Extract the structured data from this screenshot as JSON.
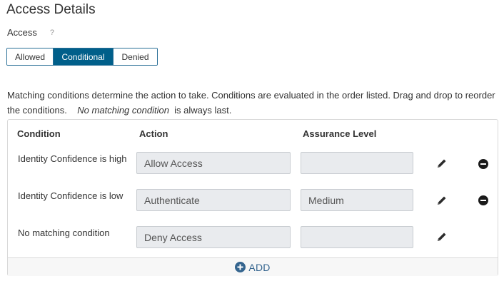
{
  "page": {
    "title": "Access Details"
  },
  "access": {
    "label": "Access",
    "help": "?",
    "options": [
      "Allowed",
      "Conditional",
      "Denied"
    ],
    "selected": "Conditional"
  },
  "description": {
    "part1": "Matching conditions determine the action to take. Conditions are evaluated in the order listed. Drag and drop to reorder the conditions.",
    "emphasis": "No matching condition",
    "part2": "is always last."
  },
  "table": {
    "headers": {
      "condition": "Condition",
      "action": "Action",
      "level": "Assurance Level"
    },
    "rows": [
      {
        "condition": "Identity Confidence is high",
        "action": "Allow Access",
        "level": "",
        "removable": true
      },
      {
        "condition": "Identity Confidence is low",
        "action": "Authenticate",
        "level": "Medium",
        "removable": true
      },
      {
        "condition": "No matching condition",
        "action": "Deny Access",
        "level": "",
        "removable": false
      }
    ],
    "add_label": "ADD"
  },
  "colors": {
    "accent": "#005f8a",
    "add_link": "#35658f",
    "field_bg": "#e9ebee"
  },
  "icons": {
    "help": "question-icon",
    "edit": "pencil-icon",
    "remove": "minus-circle-icon",
    "add": "plus-circle-icon"
  }
}
